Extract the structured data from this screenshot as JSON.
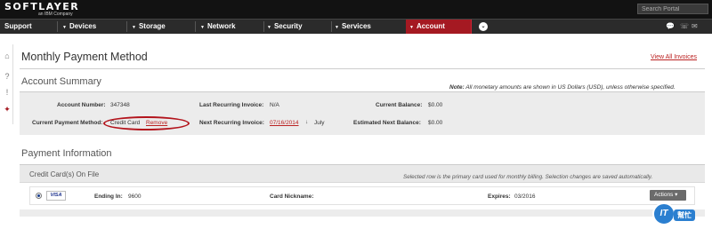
{
  "brand": {
    "name": "SOFTLAYER",
    "subtitle": "an IBM Company"
  },
  "search": {
    "placeholder": "Search Portal"
  },
  "nav": {
    "items": [
      "Support",
      "Devices",
      "Storage",
      "Network",
      "Security",
      "Services",
      "Account"
    ],
    "active": "Account"
  },
  "page": {
    "title": "Monthly Payment Method",
    "view_all": "View All Invoices"
  },
  "summary": {
    "title": "Account Summary",
    "note_prefix": "Note:",
    "note": "All monetary amounts are shown in US Dollars (USD), unless otherwise specified.",
    "account_number_label": "Account Number:",
    "account_number": "347348",
    "last_invoice_label": "Last Recurring Invoice:",
    "last_invoice": "N/A",
    "current_balance_label": "Current Balance:",
    "current_balance": "$0.00",
    "payment_method_label": "Current Payment Method:",
    "payment_method": "Credit Card",
    "remove": "Remove",
    "next_invoice_label": "Next Recurring Invoice:",
    "next_invoice_date": "07/16/2014",
    "next_invoice_month": "July",
    "est_balance_label": "Estimated Next Balance:",
    "est_balance": "$0.00"
  },
  "payment": {
    "title": "Payment Information",
    "cards_title": "Credit Card(s) On File",
    "cards_note": "Selected row is the primary card used for monthly billing. Selection changes are saved automatically.",
    "card": {
      "brand": "VISA",
      "ending_label": "Ending In:",
      "ending": "9600",
      "nickname_label": "Card Nickname:",
      "nickname": "",
      "expires_label": "Expires:",
      "expires": "03/2016",
      "actions": "Actions"
    }
  },
  "watermark": {
    "badge": "IT",
    "text": "幫忙"
  },
  "colors": {
    "accent": "#a51922",
    "nav_bg": "#2b2b2b",
    "top_bg": "#121212",
    "link": "#b22222"
  }
}
